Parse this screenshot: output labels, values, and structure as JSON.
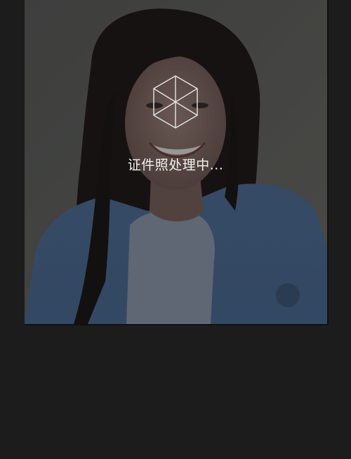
{
  "processing": {
    "icon": "hexagon-cube-icon",
    "message": "证件照处理中..."
  },
  "colors": {
    "background": "#1c1c1c",
    "text": "#f2f2f2"
  }
}
